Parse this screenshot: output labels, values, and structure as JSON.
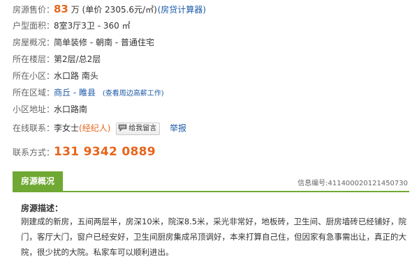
{
  "listing": {
    "price": {
      "label": "房源售价：",
      "amount": "83",
      "unit": "万",
      "unit_price": "(单价 2305.6元/㎡)",
      "calculator_link": "(房贷计算器)"
    },
    "layout": {
      "label": "户型面积：",
      "value": "8室3厅3卫 - 360 ㎡"
    },
    "overview": {
      "label": "房屋概况：",
      "value": "简单装修 - 朝南 - 普通住宅"
    },
    "floor": {
      "label": "所在楼层：",
      "value": "第2层/总2层"
    },
    "community": {
      "label": "所在小区：",
      "value": "水口路 南头"
    },
    "area": {
      "label": "所在区域：",
      "city": "商丘",
      "separator": " - ",
      "county": "睢县",
      "nearby_jobs_link": "(查看周边高薪工作)"
    },
    "address": {
      "label": "小区地址：",
      "value": "水口路南"
    },
    "contact": {
      "label": "在线联系：",
      "name": "李女士",
      "role": "(经纪人)",
      "message_button": "给我留言",
      "report_link": "举报"
    },
    "phone": {
      "label": "联系方式：",
      "value": "131 9342 0889"
    }
  },
  "section": {
    "tab_label": "房源概况",
    "info_number": "信息编号:411400020121450730",
    "description_title": "房源描述：",
    "description_text": "刚建成的新房，五间两层半，房深10米，院深8.5米，采光非常好，地板砖，卫生间、厨房墙砖已经铺好，院门，客厅大门，窗户已经安好，卫生间厨房集成吊顶调好，本来打算自己住，但因家有急事需出让，真正的大院，很少扰的大院。私家车可以顺利进出。"
  },
  "colors": {
    "accent_orange": "#e8651c",
    "link_blue": "#1d5aa8",
    "tab_green": "#6fa832"
  },
  "icons": {
    "message": "speech-bubble-icon"
  }
}
